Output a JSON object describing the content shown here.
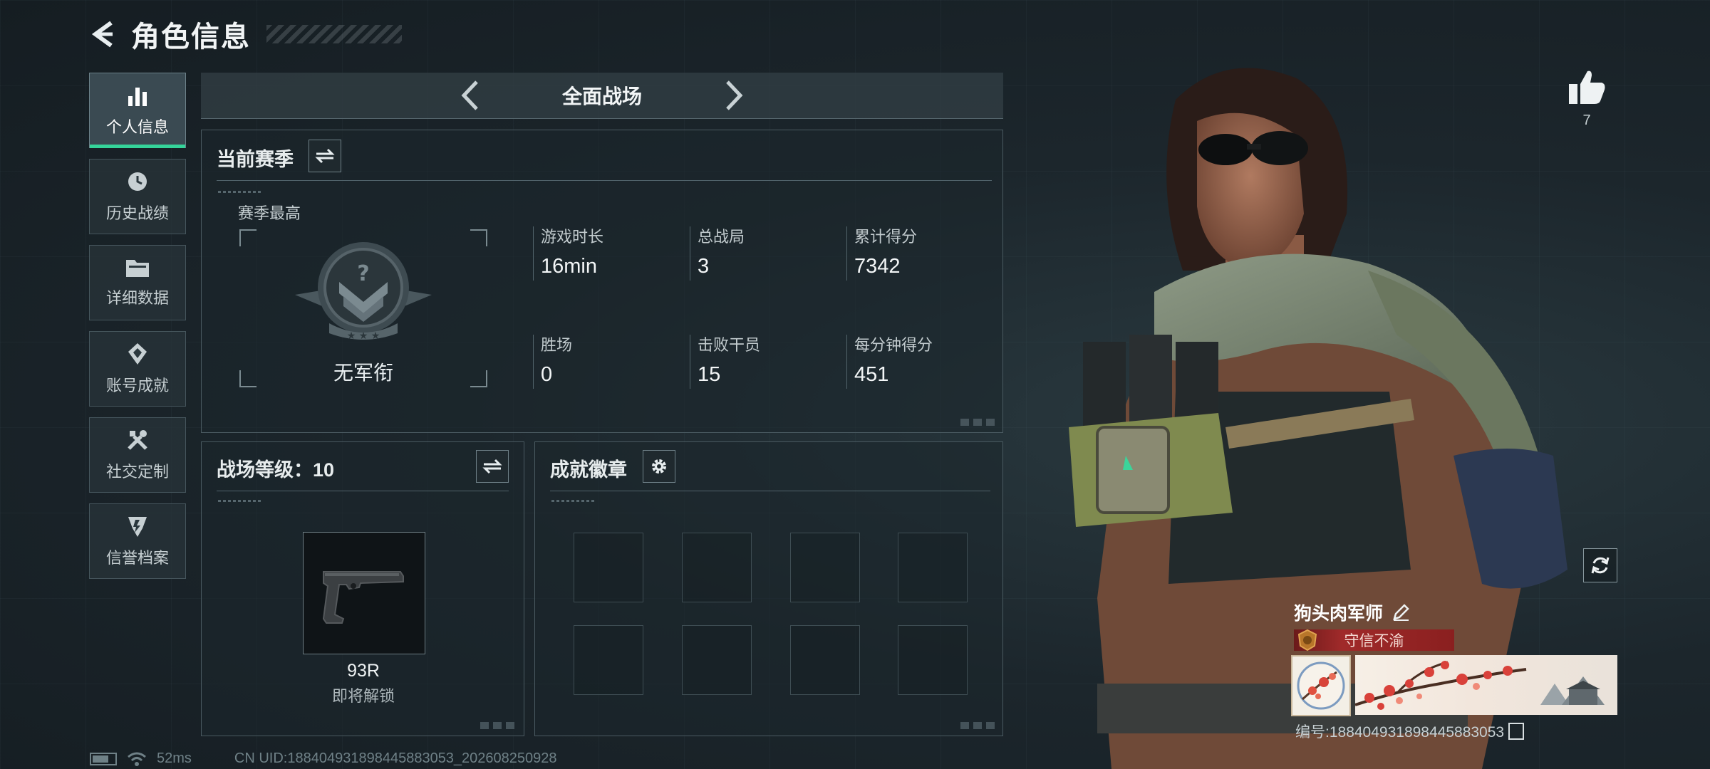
{
  "header": {
    "title": "角色信息"
  },
  "nav": {
    "items": [
      {
        "label": "个人信息",
        "icon": "bar-chart-icon",
        "active": true
      },
      {
        "label": "历史战绩",
        "icon": "history-icon",
        "active": false
      },
      {
        "label": "详细数据",
        "icon": "folder-icon",
        "active": false
      },
      {
        "label": "账号成就",
        "icon": "achievement-icon",
        "active": false
      },
      {
        "label": "社交定制",
        "icon": "tools-icon",
        "active": false
      },
      {
        "label": "信誉档案",
        "icon": "credit-shield-icon",
        "active": false
      }
    ]
  },
  "mode": {
    "name": "全面战场"
  },
  "season": {
    "title": "当前赛季",
    "subtitle": "赛季最高",
    "rank_name": "无军衔",
    "stats": [
      {
        "label": "游戏时长",
        "value": "16min"
      },
      {
        "label": "总战局",
        "value": "3"
      },
      {
        "label": "累计得分",
        "value": "7342"
      },
      {
        "label": "胜场",
        "value": "0"
      },
      {
        "label": "击败干员",
        "value": "15"
      },
      {
        "label": "每分钟得分",
        "value": "451"
      }
    ]
  },
  "battlefield_level": {
    "title": "战场等级：10",
    "weapon_name": "93R",
    "weapon_status": "即将解锁"
  },
  "achievements": {
    "title": "成就徽章",
    "slot_count": 8
  },
  "profile": {
    "likes": "7",
    "nickname": "狗头肉军师",
    "title_badge": "守信不渝",
    "uid_line": "编号:18840493189844588​3053"
  },
  "footer": {
    "ping": "52ms",
    "uid": "CN UID:18840493189844588​3053_202608250928"
  },
  "colors": {
    "accent": "#35d49a",
    "title_badge": "#a02a2a",
    "panel_border": "#4a5a61"
  }
}
